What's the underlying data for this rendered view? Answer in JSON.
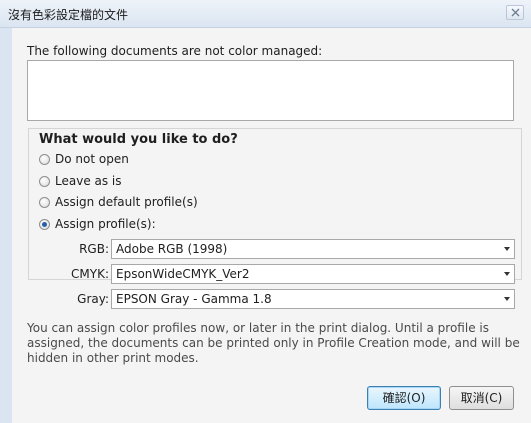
{
  "window": {
    "title": "沒有色彩設定檔的文件",
    "close_icon": "close-icon"
  },
  "documents": {
    "label": "The following documents are not color managed:",
    "items": []
  },
  "choice": {
    "heading": "What would you like to do?",
    "options": [
      {
        "label": "Do not open",
        "selected": false
      },
      {
        "label": "Leave as is",
        "selected": false
      },
      {
        "label": "Assign default profile(s)",
        "selected": false
      },
      {
        "label": "Assign profile(s):",
        "selected": true
      }
    ]
  },
  "profiles": {
    "rgb": {
      "label": "RGB:",
      "value": "Adobe RGB (1998)"
    },
    "cmyk": {
      "label": "CMYK:",
      "value": "EpsonWideCMYK_Ver2"
    },
    "gray": {
      "label": "Gray:",
      "value": "EPSON  Gray - Gamma 1.8"
    }
  },
  "note": "You can assign color profiles now, or later in the print dialog. Until a profile is assigned, the documents can be printed only in Profile Creation mode, and will be hidden in other print modes.",
  "buttons": {
    "ok_label": "確認(O)",
    "cancel_label": "取消(C)"
  }
}
